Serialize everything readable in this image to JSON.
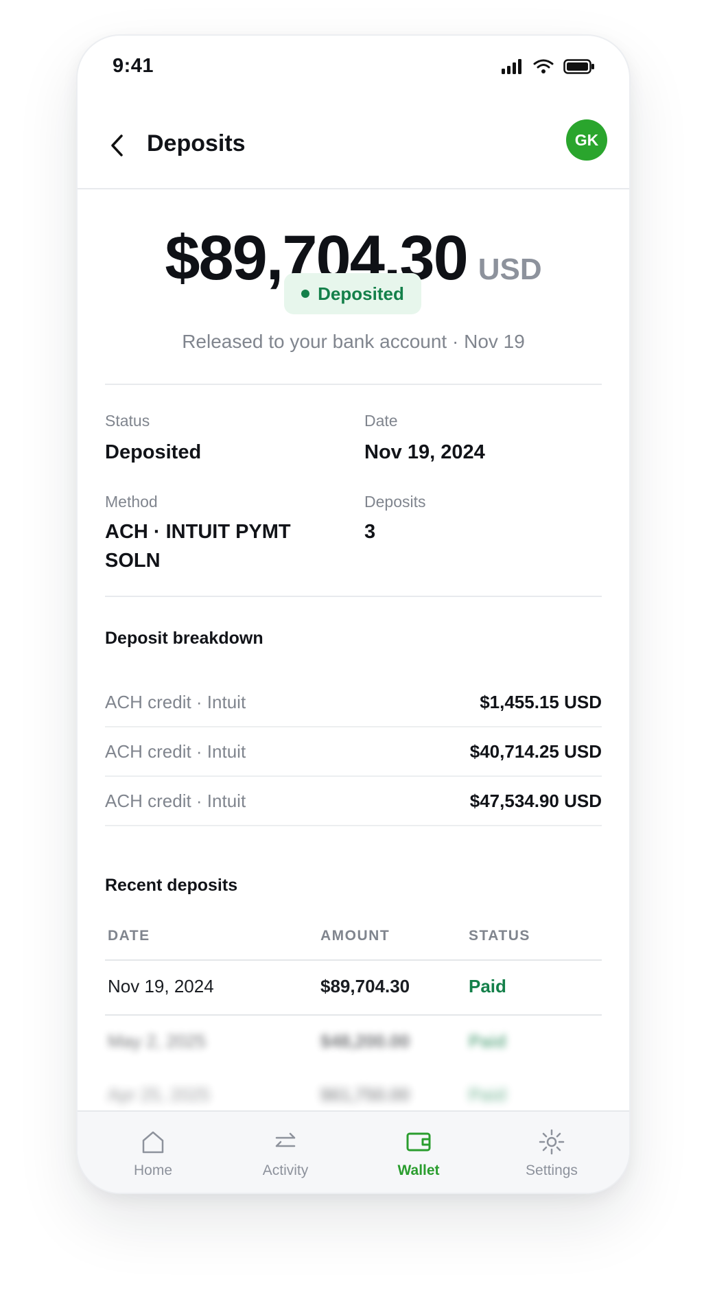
{
  "status_bar": {
    "time": "9:41"
  },
  "header": {
    "title": "Deposits",
    "avatar_initials": "GK"
  },
  "hero": {
    "amount": "$89,704.30",
    "currency": "USD",
    "status_pill": "Deposited",
    "subtitle": "Released to your bank account · Nov 19"
  },
  "details": {
    "status_label": "Status",
    "status_value": "Deposited",
    "date_label": "Date",
    "date_value": "Nov 19, 2024",
    "method_label": "Method",
    "method_value_line1": "ACH · INTUIT PYMT",
    "method_value_line2": "SOLN",
    "deposits_label": "Deposits",
    "deposits_value": "3"
  },
  "breakdown": {
    "title": "Deposit breakdown",
    "items": [
      {
        "label": "ACH credit · Intuit",
        "amount": "$1,455.15 USD"
      },
      {
        "label": "ACH credit · Intuit",
        "amount": "$40,714.25 USD"
      },
      {
        "label": "ACH credit · Intuit",
        "amount": "$47,534.90 USD"
      }
    ]
  },
  "recent": {
    "title": "Recent deposits",
    "columns": [
      "DATE",
      "AMOUNT",
      "STATUS"
    ],
    "rows": [
      {
        "date": "Nov 19, 2024",
        "amount": "$89,704.30",
        "status": "Paid"
      },
      {
        "date": "May 2, 2025",
        "amount": "$48,200.00",
        "status": "Paid"
      },
      {
        "date": "Apr 25, 2025",
        "amount": "$61,750.00",
        "status": "Paid"
      }
    ]
  },
  "tabbar": {
    "items": [
      {
        "label": "Home",
        "icon": "home-icon"
      },
      {
        "label": "Activity",
        "icon": "transfer-icon"
      },
      {
        "label": "Wallet",
        "icon": "wallet-icon"
      },
      {
        "label": "Settings",
        "icon": "settings-icon"
      }
    ],
    "active": "Wallet"
  },
  "colors": {
    "accent_green": "#2aa52d",
    "status_green": "#14804a",
    "pill_bg": "#e7f6ec",
    "muted_text": "#80858e"
  }
}
